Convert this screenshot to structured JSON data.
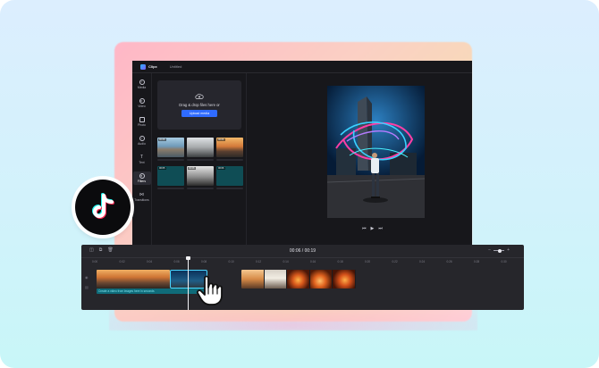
{
  "app": {
    "brand": "Clipx",
    "project_name": "Untitled"
  },
  "sidebar": {
    "items": [
      {
        "label": "Media",
        "icon": "media-icon"
      },
      {
        "label": "Video",
        "icon": "video-icon"
      },
      {
        "label": "Photo",
        "icon": "photo-icon"
      },
      {
        "label": "Audio",
        "icon": "audio-icon"
      },
      {
        "label": "Text",
        "icon": "text-icon"
      },
      {
        "label": "Filters",
        "icon": "filters-icon",
        "active": true
      },
      {
        "label": "Transitions",
        "icon": "transitions-icon"
      }
    ]
  },
  "upload": {
    "text": "Drag & drop files here or",
    "button": "Upload media"
  },
  "media_thumbs": [
    {
      "duration": "00:08"
    },
    {
      "duration": ""
    },
    {
      "duration": "00:06"
    },
    {
      "duration": "00:05"
    },
    {
      "duration": "00:08"
    },
    {
      "duration": "00:06"
    }
  ],
  "timeline": {
    "timecode": "00:06 / 00:19",
    "ruler": [
      "0:00",
      "0:02",
      "0:04",
      "0:06",
      "0:08",
      "0:10",
      "0:12",
      "0:14",
      "0:16",
      "0:18",
      "0:20",
      "0:22",
      "0:24",
      "0:26",
      "0:28",
      "0:30"
    ],
    "caption": "Create a video from images here in seconds"
  },
  "colors": {
    "accent": "#2f6bff",
    "selection": "#4ad6ff",
    "caption_track": "#0f6b79"
  }
}
